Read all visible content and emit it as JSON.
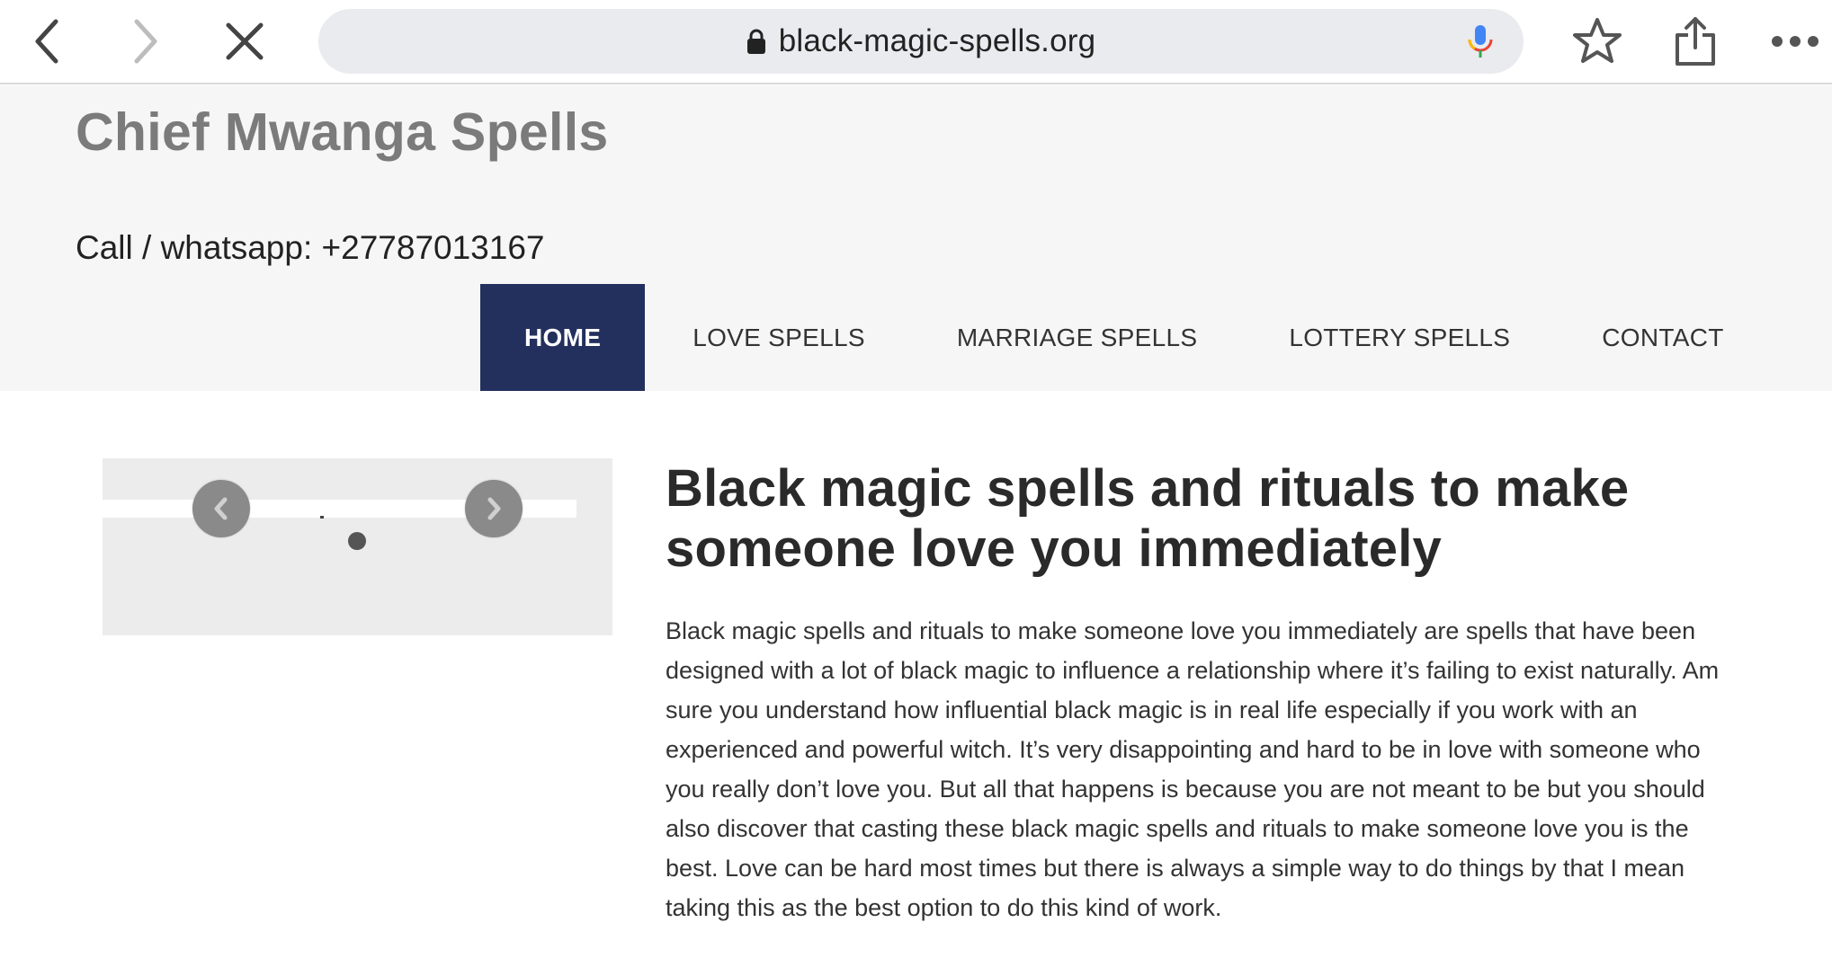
{
  "browser": {
    "url": "black-magic-spells.org",
    "icons": {
      "back": "chevron-left-icon",
      "forward": "chevron-right-icon",
      "stop": "close-icon",
      "lock": "lock-icon",
      "mic": "microphone-icon",
      "bookmark": "star-icon",
      "share": "share-icon",
      "more": "more-icon"
    },
    "colors": {
      "toolbar_bg": "#ffffff",
      "urlbar_bg": "#e9ebee"
    }
  },
  "site": {
    "title": "Chief Mwanga Spells",
    "phone": "Call / whatsapp: +27787013167",
    "nav": [
      {
        "label": "HOME",
        "active": true
      },
      {
        "label": "LOVE SPELLS",
        "active": false
      },
      {
        "label": "MARRIAGE SPELLS",
        "active": false
      },
      {
        "label": "LOTTERY SPELLS",
        "active": false
      },
      {
        "label": "CONTACT",
        "active": false
      }
    ],
    "colors": {
      "header_bg": "#f6f6f6",
      "nav_active_bg": "#23305d",
      "title": "#7b7b7b"
    }
  },
  "slider": {
    "icons": {
      "prev": "chevron-left-icon",
      "next": "chevron-right-icon"
    }
  },
  "article": {
    "heading": "Black magic spells and rituals to make someone love you immediately",
    "body": "Black magic spells and rituals to make someone love you immediately are spells that have been designed with a lot of black magic to influence a relationship where it’s failing to exist naturally. Am sure you understand how influential black magic is in real life especially if you work with an experienced and powerful witch. It’s very disappointing and hard to be in love with someone who you really don’t love you. But all that happens is because you are not meant to be but you should also discover that casting these black magic spells and rituals to make someone love you is the best. Love can be hard most times but there is always a simple way to do things by that I mean taking this as the best option to do this kind of work."
  }
}
